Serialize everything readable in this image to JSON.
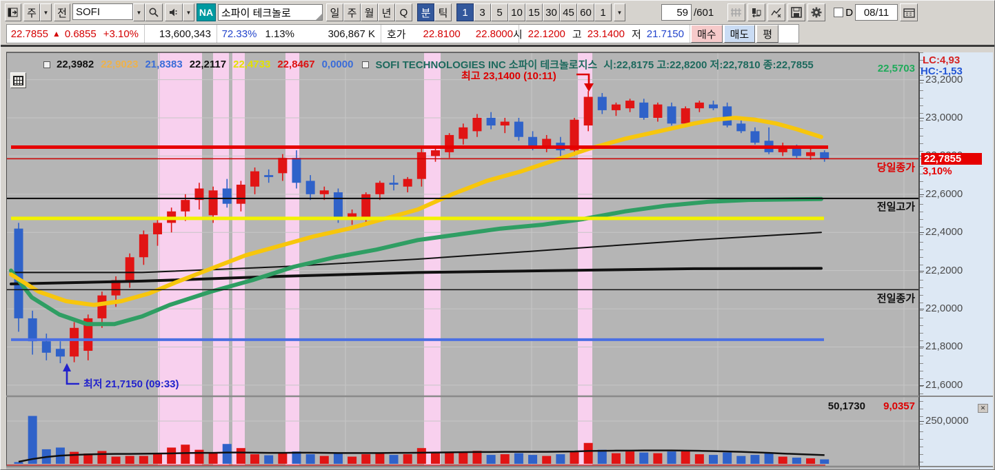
{
  "toolbar": {
    "period_quick": "주",
    "prev_button": "전",
    "symbol_input": "SOFI",
    "flag_badge": "NA",
    "stock_name": "소파이 테크놀로",
    "period_buttons": [
      "일",
      "주",
      "월",
      "년",
      "Q"
    ],
    "mode_buttons": [
      {
        "label": "분",
        "active": true
      },
      {
        "label": "틱",
        "active": false
      }
    ],
    "interval_buttons": [
      {
        "label": "1",
        "active": true
      },
      {
        "label": "3",
        "active": false
      },
      {
        "label": "5",
        "active": false
      },
      {
        "label": "10",
        "active": false
      },
      {
        "label": "15",
        "active": false
      },
      {
        "label": "30",
        "active": false
      },
      {
        "label": "45",
        "active": false
      },
      {
        "label": "60",
        "active": false
      },
      {
        "label": "1",
        "active": false
      }
    ],
    "bar_count": "59",
    "bar_total": "/601",
    "d_checkbox_label": "D",
    "date_value": "08/11"
  },
  "quote_bar": {
    "price": "22.7855",
    "arrow": "▲",
    "change": "0.6855",
    "change_pct": "+3.10%",
    "volume": "13,600,343",
    "ratio1": "72.33%",
    "ratio2": "1.13%",
    "amount": "306,867 K",
    "hoga_label": "호가",
    "ask": "22.8100",
    "bid": "22.8000",
    "open_label": "시",
    "open": "22.1200",
    "high_label": "고",
    "high": "23.1400",
    "low_label": "저",
    "low": "21.7150",
    "buy_button": "매수",
    "sell_button": "매도",
    "avg_button": "평"
  },
  "chart": {
    "legend_values": [
      {
        "text": "22,3982",
        "color": "#111111"
      },
      {
        "text": "22,9023",
        "color": "#eeb24a"
      },
      {
        "text": "21,8383",
        "color": "#3a6cd8"
      },
      {
        "text": "22,2117",
        "color": "#111111"
      },
      {
        "text": "22,4733",
        "color": "#e2e200"
      },
      {
        "text": "22,8467",
        "color": "#dd1111"
      },
      {
        "text": "0,0000",
        "color": "#3a6cd8"
      }
    ],
    "title": "SOFI TECHNOLOGIES INC  소파이 테크놀로지스",
    "title_ohlc": "시:22,8175 고:22,8200 저:22,7810 종:22,7855",
    "green_value": "22,5703",
    "lc_value": "LC:4,93",
    "hc_value": "HC:-1,53",
    "high_annotation": "최고 23,1400 (10:11)",
    "low_annotation": "최저 21,7150 (09:33)",
    "day_close_label": "당일종가",
    "prev_high_label": "전일고가",
    "prev_close_label": "전일종가",
    "vol_ma_value": "50,1730",
    "vol_cur_value": "9,0357",
    "axis": {
      "price_labels": [
        {
          "text": "23,2000",
          "value": 23.2
        },
        {
          "text": "23,0000",
          "value": 23.0
        },
        {
          "text": "22,8000",
          "value": 22.8
        },
        {
          "text": "22,6000",
          "value": 22.6
        },
        {
          "text": "22,4000",
          "value": 22.4
        },
        {
          "text": "22,2000",
          "value": 22.2
        },
        {
          "text": "22,0000",
          "value": 22.0
        },
        {
          "text": "21,8000",
          "value": 21.8
        },
        {
          "text": "21,6000",
          "value": 21.6
        }
      ],
      "badge_price": "22,7855",
      "badge_pct": "3,10%",
      "volume_label": {
        "text": "250,0000",
        "value": 250
      }
    },
    "chart_data": {
      "type": "candlestick+volume",
      "x_unit": "1-minute bars",
      "visible_bars": 59,
      "price_axis_range": [
        21.55,
        23.25
      ],
      "session_high": {
        "price": 23.14,
        "time": "10:11",
        "bar_index": 41
      },
      "session_low": {
        "price": 21.715,
        "time": "09:33",
        "bar_index": 3
      },
      "candles": [
        [
          22.42,
          22.45,
          21.88,
          21.95
        ],
        [
          21.95,
          21.99,
          21.76,
          21.83
        ],
        [
          21.83,
          21.87,
          21.73,
          21.77
        ],
        [
          21.79,
          21.83,
          21.715,
          21.75
        ],
        [
          21.75,
          21.93,
          21.72,
          21.9
        ],
        [
          21.78,
          21.97,
          21.73,
          21.95
        ],
        [
          21.95,
          22.09,
          21.9,
          22.07
        ],
        [
          22.07,
          22.17,
          22.01,
          22.15
        ],
        [
          22.15,
          22.29,
          22.11,
          22.27
        ],
        [
          22.27,
          22.41,
          22.23,
          22.39
        ],
        [
          22.39,
          22.47,
          22.33,
          22.45
        ],
        [
          22.45,
          22.53,
          22.4,
          22.51
        ],
        [
          22.51,
          22.6,
          22.46,
          22.57
        ],
        [
          22.57,
          22.66,
          22.52,
          22.63
        ],
        [
          22.49,
          22.64,
          22.45,
          22.62
        ],
        [
          22.63,
          22.68,
          22.53,
          22.55
        ],
        [
          22.55,
          22.67,
          22.51,
          22.65
        ],
        [
          22.64,
          22.74,
          22.6,
          22.72
        ],
        [
          22.7,
          22.73,
          22.66,
          22.69
        ],
        [
          22.71,
          22.81,
          22.67,
          22.79
        ],
        [
          22.79,
          22.83,
          22.63,
          22.66
        ],
        [
          22.67,
          22.7,
          22.57,
          22.6
        ],
        [
          22.6,
          22.64,
          22.57,
          22.62
        ],
        [
          22.61,
          22.63,
          22.45,
          22.47
        ],
        [
          22.47,
          22.52,
          22.44,
          22.5
        ],
        [
          22.48,
          22.61,
          22.45,
          22.6
        ],
        [
          22.6,
          22.67,
          22.57,
          22.66
        ],
        [
          22.66,
          22.7,
          22.62,
          22.65
        ],
        [
          22.64,
          22.69,
          22.61,
          22.68
        ],
        [
          22.68,
          22.84,
          22.64,
          22.82
        ],
        [
          22.8,
          22.85,
          22.77,
          22.83
        ],
        [
          22.82,
          22.92,
          22.79,
          22.91
        ],
        [
          22.89,
          22.97,
          22.86,
          22.95
        ],
        [
          22.93,
          23.02,
          22.9,
          23.0
        ],
        [
          23.0,
          23.03,
          22.94,
          22.96
        ],
        [
          22.96,
          23.0,
          22.92,
          22.98
        ],
        [
          22.98,
          23.0,
          22.88,
          22.9
        ],
        [
          22.9,
          22.93,
          22.83,
          22.85
        ],
        [
          22.85,
          22.91,
          22.82,
          22.89
        ],
        [
          22.87,
          22.9,
          22.8,
          22.83
        ],
        [
          22.83,
          23.0,
          22.8,
          22.99
        ],
        [
          22.96,
          23.14,
          22.93,
          23.11
        ],
        [
          23.11,
          23.13,
          23.02,
          23.04
        ],
        [
          23.04,
          23.08,
          23.01,
          23.07
        ],
        [
          23.05,
          23.1,
          23.03,
          23.09
        ],
        [
          23.08,
          23.1,
          22.99,
          23.0
        ],
        [
          23.0,
          23.08,
          22.98,
          23.07
        ],
        [
          23.06,
          23.08,
          22.96,
          22.97
        ],
        [
          22.97,
          23.06,
          22.95,
          23.05
        ],
        [
          23.05,
          23.09,
          23.03,
          23.08
        ],
        [
          23.07,
          23.09,
          23.04,
          23.05
        ],
        [
          23.06,
          23.08,
          22.95,
          22.96
        ],
        [
          22.97,
          22.99,
          22.92,
          22.93
        ],
        [
          22.93,
          22.95,
          22.86,
          22.87
        ],
        [
          22.88,
          22.95,
          22.81,
          22.82
        ],
        [
          22.82,
          22.87,
          22.8,
          22.85
        ],
        [
          22.85,
          22.86,
          22.79,
          22.8
        ],
        [
          22.8,
          22.84,
          22.78,
          22.82
        ],
        [
          22.82,
          22.83,
          22.77,
          22.785
        ]
      ],
      "volumes": [
        10,
        280,
        85,
        95,
        70,
        60,
        75,
        42,
        46,
        46,
        56,
        95,
        112,
        82,
        66,
        116,
        92,
        56,
        50,
        62,
        72,
        56,
        46,
        66,
        42,
        56,
        62,
        52,
        56,
        92,
        62,
        66,
        70,
        76,
        52,
        56,
        62,
        52,
        46,
        56,
        72,
        122,
        82,
        62,
        72,
        66,
        62,
        72,
        76,
        56,
        52,
        66,
        46,
        52,
        62,
        42,
        36,
        32,
        26
      ],
      "volume_ma": [
        12,
        28,
        40,
        48,
        52,
        55,
        57,
        58,
        58,
        59,
        60,
        61,
        63,
        64,
        64,
        66,
        66,
        65,
        64,
        64,
        65,
        65,
        64,
        63,
        63,
        63,
        63,
        64,
        64,
        65,
        66,
        67,
        68,
        69,
        69,
        70,
        70,
        70,
        70,
        71,
        72,
        75,
        76,
        77,
        77,
        78,
        78,
        78,
        77,
        76,
        74,
        72,
        70,
        67,
        64,
        60,
        57,
        54,
        51
      ],
      "overlays": {
        "green_ma": {
          "color": "#2f9e63",
          "width": 6,
          "points": [
            [
              15,
              22.2
            ],
            [
              45,
              22.06
            ],
            [
              85,
              21.97
            ],
            [
              125,
              21.92
            ],
            [
              165,
              21.92
            ],
            [
              205,
              21.96
            ],
            [
              245,
              22.02
            ],
            [
              305,
              22.09
            ],
            [
              365,
              22.15
            ],
            [
              425,
              22.22
            ],
            [
              485,
              22.27
            ],
            [
              545,
              22.31
            ],
            [
              605,
              22.36
            ],
            [
              665,
              22.39
            ],
            [
              725,
              22.42
            ],
            [
              785,
              22.44
            ],
            [
              845,
              22.47
            ],
            [
              905,
              22.51
            ],
            [
              965,
              22.54
            ],
            [
              1025,
              22.56
            ],
            [
              1085,
              22.57
            ],
            [
              1190,
              22.575
            ]
          ]
        },
        "gold_ma": {
          "color": "#f7c60c",
          "width": 6,
          "points": [
            [
              15,
              22.18
            ],
            [
              55,
              22.09
            ],
            [
              95,
              22.04
            ],
            [
              135,
              22.02
            ],
            [
              175,
              22.04
            ],
            [
              215,
              22.08
            ],
            [
              255,
              22.14
            ],
            [
              305,
              22.21
            ],
            [
              355,
              22.28
            ],
            [
              405,
              22.33
            ],
            [
              455,
              22.38
            ],
            [
              505,
              22.42
            ],
            [
              555,
              22.47
            ],
            [
              605,
              22.52
            ],
            [
              655,
              22.6
            ],
            [
              705,
              22.67
            ],
            [
              755,
              22.72
            ],
            [
              805,
              22.78
            ],
            [
              855,
              22.84
            ],
            [
              905,
              22.89
            ],
            [
              955,
              22.93
            ],
            [
              1005,
              22.97
            ],
            [
              1035,
              22.99
            ],
            [
              1065,
              23.0
            ],
            [
              1095,
              22.99
            ],
            [
              1125,
              22.97
            ],
            [
              1155,
              22.94
            ],
            [
              1190,
              22.9
            ]
          ]
        },
        "black_ma_thin": {
          "color": "#111111",
          "width": 2,
          "points": [
            [
              15,
              22.19
            ],
            [
              205,
              22.19
            ],
            [
              405,
              22.22
            ],
            [
              605,
              22.26
            ],
            [
              805,
              22.31
            ],
            [
              1005,
              22.36
            ],
            [
              1190,
              22.4
            ]
          ]
        },
        "black_ma_thick": {
          "color": "#111111",
          "width": 4,
          "points": [
            [
              15,
              22.13
            ],
            [
              205,
              22.145
            ],
            [
              405,
              22.17
            ],
            [
              605,
              22.19
            ],
            [
              805,
              22.2
            ],
            [
              1005,
              22.21
            ],
            [
              1190,
              22.212
            ]
          ]
        }
      },
      "h_lines": {
        "red_thick": {
          "value": 22.8467,
          "color": "#e60000",
          "width": 5
        },
        "yellow": {
          "value": 22.4733,
          "color": "#f2f200",
          "width": 5
        },
        "blue": {
          "value": 21.8383,
          "color": "#4a6fe3",
          "width": 4
        },
        "day_close": {
          "value": 22.7855,
          "color": "#cc0000",
          "width": 1.5
        },
        "prev_high": {
          "value": 22.578,
          "color": "#111111",
          "width": 2.2
        },
        "prev_close": {
          "value": 22.1,
          "color": "#111111",
          "width": 1.4
        }
      },
      "pink_bands": [
        [
          228,
          292
        ],
        [
          308,
          331
        ],
        [
          336,
          354
        ],
        [
          413,
          433
        ],
        [
          614,
          638
        ],
        [
          837,
          858
        ]
      ],
      "grid": {
        "price_levels": [
          23.2,
          23.0,
          22.8,
          22.6,
          22.4,
          22.2,
          22.0,
          21.8,
          21.6
        ],
        "x_lines": [
          230,
          500,
          770,
          1040,
          1310
        ],
        "volume_level": 250
      },
      "colors": {
        "up": "#e11414",
        "down": "#2f62c9",
        "band": "#f8d0ee",
        "plot_bg": "#b5b5b5",
        "grid": "#c6c6c6"
      }
    }
  }
}
